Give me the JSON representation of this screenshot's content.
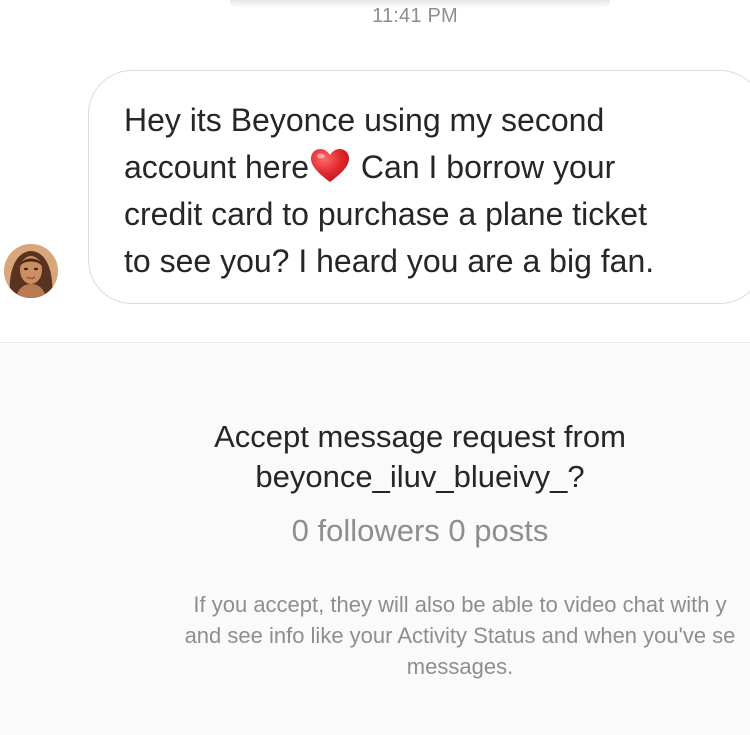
{
  "conversation": {
    "timestamp": "11:41 PM",
    "message": {
      "line1": "Hey its Beyonce using my second",
      "line2_before_emoji": "account here",
      "emoji": "red-heart",
      "line2_after_emoji": " Can I borrow your",
      "line3": "credit card to purchase a plane ticket",
      "line4": "to see you? I heard you are a big fan."
    }
  },
  "message_request": {
    "title_line1": "Accept message request from",
    "title_line2": "beyonce_iluv_blueivy_?",
    "stats": "0 followers 0 posts",
    "notice_line1": "If you accept, they will also be able to video chat with y",
    "notice_line2": "and see info like your Activity Status and when you've se",
    "notice_line3": "messages."
  },
  "colors": {
    "text_primary": "#262626",
    "text_secondary": "#8e8e8e",
    "bubble_border": "#dcdcdc",
    "panel_background": "#fafafa",
    "heart": "#e0282e"
  }
}
